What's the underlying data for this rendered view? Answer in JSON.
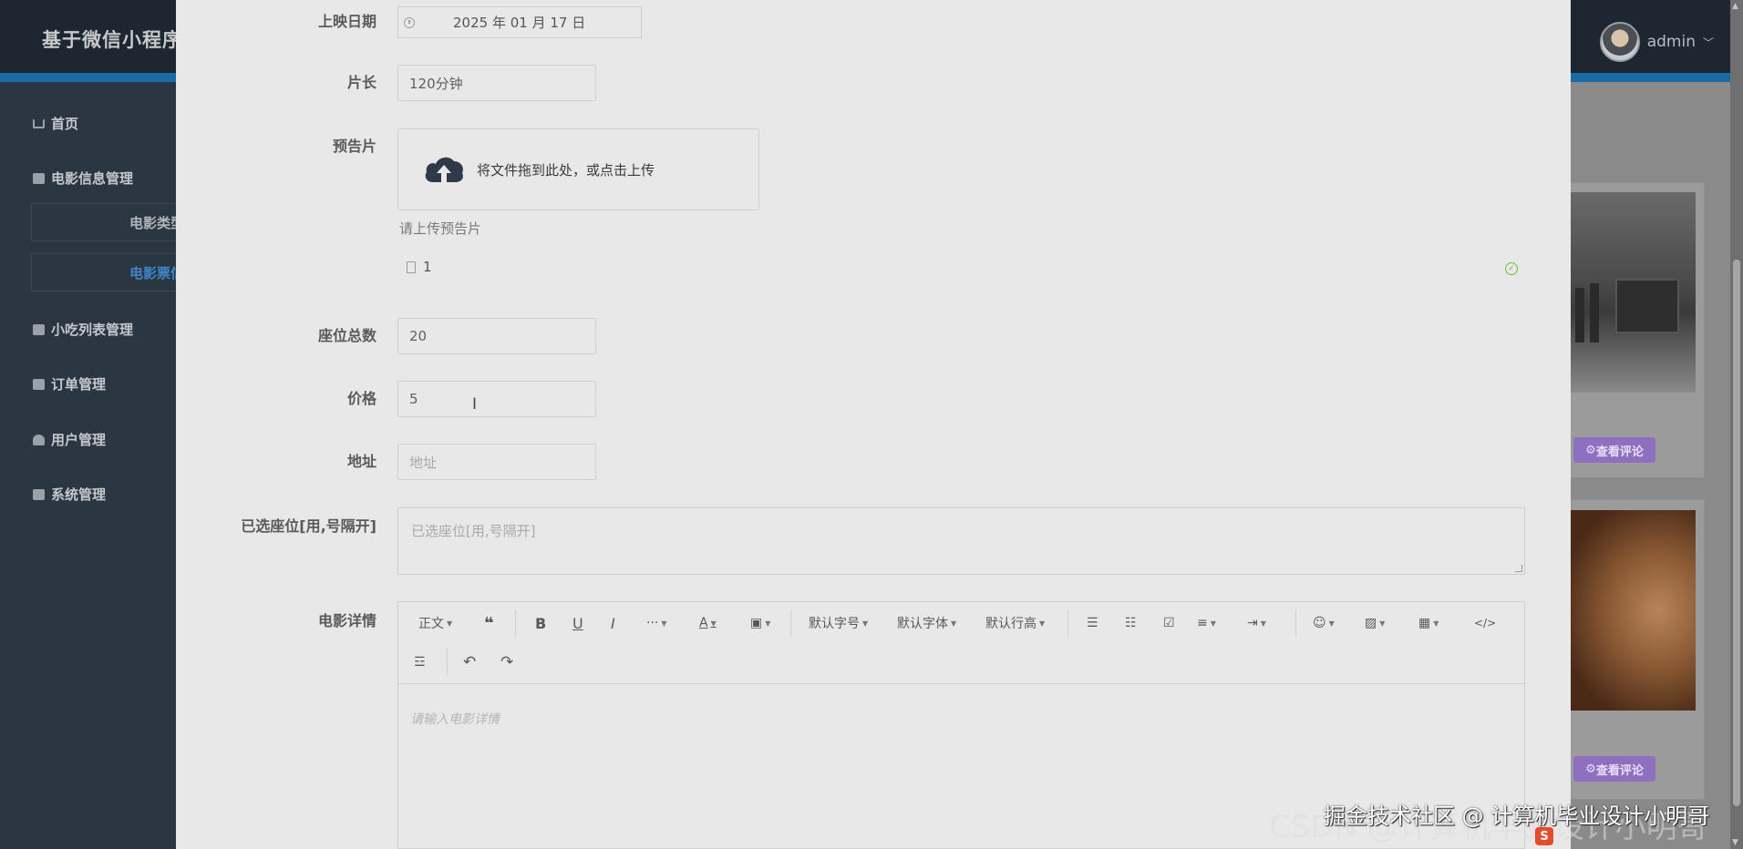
{
  "app": {
    "title": "基于微信小程序",
    "user": "admin"
  },
  "sidebar": {
    "items": [
      {
        "label": "首页",
        "icon": "home-icon"
      },
      {
        "label": "电影信息管理",
        "icon": "folder-icon"
      },
      {
        "label": "小吃列表管理",
        "icon": "briefcase-icon"
      },
      {
        "label": "订单管理",
        "icon": "grid-icon"
      },
      {
        "label": "用户管理",
        "icon": "user-icon"
      },
      {
        "label": "系统管理",
        "icon": "cog-icon"
      }
    ],
    "sub": [
      {
        "label": "电影类型"
      },
      {
        "label": "电影票信"
      }
    ]
  },
  "bg_cards": {
    "comment_label": "查看评论"
  },
  "form": {
    "release_date": {
      "label": "上映日期",
      "value": "2025 年 01 月 17 日"
    },
    "duration": {
      "label": "片长",
      "value": "120分钟"
    },
    "trailer": {
      "label": "预告片",
      "drop_text": "将文件拖到此处，或点击上传",
      "tip": "请上传预告片",
      "file_name": "1"
    },
    "seats_total": {
      "label": "座位总数",
      "value": "20"
    },
    "price": {
      "label": "价格",
      "value": "5"
    },
    "address": {
      "label": "地址",
      "placeholder": "地址"
    },
    "selected_seats": {
      "label": "已选座位[用,号隔开]",
      "placeholder": "已选座位[用,号隔开]"
    },
    "details": {
      "label": "电影详情",
      "placeholder": "请输入电影详情",
      "toolbar": {
        "paragraph": "正文",
        "font_size": "默认字号",
        "font_family": "默认字体",
        "line_height": "默认行高"
      }
    }
  },
  "watermark": {
    "csdn": "CSDN @计算机毕业设计小明哥",
    "juejin": "掘金技术社区 @ 计算机毕业设计小明哥"
  },
  "colors": {
    "sidebar_bg": "#2b3643",
    "header_bg": "#1d2631",
    "accent": "#1a6aa5",
    "modal_bg": "#e8e8e8",
    "success": "#67c23a",
    "comment_btn": "#8e6fc0"
  }
}
